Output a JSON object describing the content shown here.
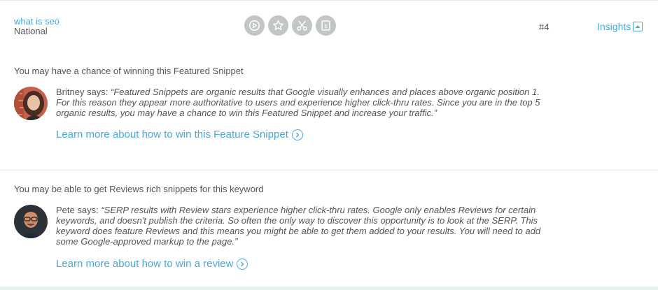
{
  "keyword": {
    "term": "what is seo",
    "location": "National"
  },
  "serp_features": [
    {
      "icon": "play-circle-icon"
    },
    {
      "icon": "star-icon"
    },
    {
      "icon": "scissors-icon"
    },
    {
      "icon": "dollar-document-icon"
    }
  ],
  "rank": "#4",
  "insights_label": "Insights",
  "insights": [
    {
      "title": "You may have a chance of winning this Featured Snippet",
      "speaker": "Britney says: ",
      "quote": "“Featured Snippets are organic results that Google visually enhances and places above organic position 1. For this reason they appear more authoritative to users and experience higher click-thru rates. Since you are in the top 5 organic results, you may have a chance to win this Featured Snippet and increase your traffic.”",
      "link": "Learn more about how to win this Feature Snippet"
    },
    {
      "title": "You may be able to get Reviews rich snippets for this keyword",
      "speaker": "Pete says: ",
      "quote": "“SERP results with Review stars experience higher click-thru rates. Google only enables Reviews for certain keywords, and doesn't publish the criteria. So often the only way to discover this opportunity is to look at the SERP. This keyword does feature Reviews and this means you might be able to get them added to your results. You will need to add some Google-approved markup to the page.”",
      "link": "Learn more about how to win a review"
    }
  ],
  "colors": {
    "link": "#49a9d8",
    "text": "#555555",
    "icon_bg": "#c3c6c7"
  }
}
